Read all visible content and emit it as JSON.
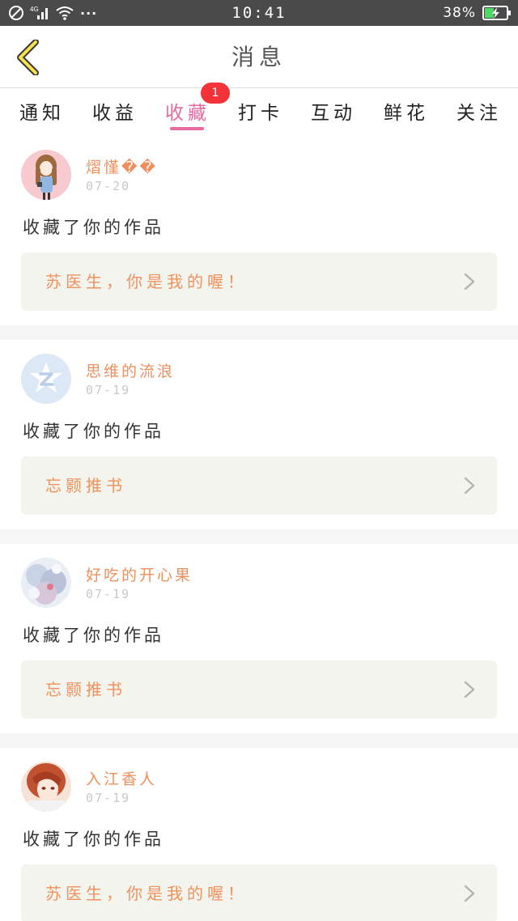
{
  "status_bar": {
    "time": "10:41",
    "battery": "38%",
    "more_dots": "···",
    "network": "4G"
  },
  "header": {
    "title": "消息",
    "back_icon": "chevron-left-icon"
  },
  "tabs": [
    {
      "label": "通知",
      "active": false
    },
    {
      "label": "收益",
      "active": false
    },
    {
      "label": "收藏",
      "active": true,
      "badge": "1"
    },
    {
      "label": "打卡",
      "active": false
    },
    {
      "label": "互动",
      "active": false
    },
    {
      "label": "鲜花",
      "active": false
    },
    {
      "label": "关注",
      "active": false
    }
  ],
  "colors": {
    "accent_pink": "#e56aa0",
    "badge_red": "#f5323a",
    "orange_text": "#f08f5c",
    "work_box_bg": "#f4f4ef",
    "status_bar_bg": "#4a4a4a"
  },
  "notifications": [
    {
      "username": "熠慬��",
      "date": "07-20",
      "action": "收藏了你的作品",
      "work_title": "苏医生，你是我的喔！"
    },
    {
      "username": "思维的流浪",
      "date": "07-19",
      "action": "收藏了你的作品",
      "work_title": "忘颢推书"
    },
    {
      "username": "好吃的开心果",
      "date": "07-19",
      "action": "收藏了你的作品",
      "work_title": "忘颢推书"
    },
    {
      "username": "入江香人",
      "date": "07-19",
      "action": "收藏了你的作品",
      "work_title": "苏医生，你是我的喔！"
    }
  ]
}
